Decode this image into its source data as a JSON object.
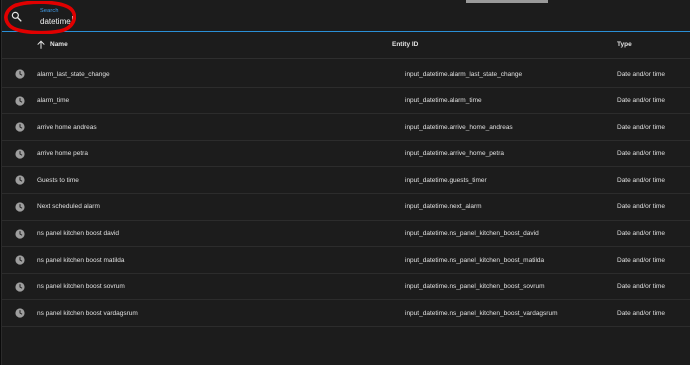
{
  "search": {
    "label": "Search",
    "value": "datetime"
  },
  "table": {
    "columns": {
      "name": "Name",
      "entity_id": "Entity ID",
      "type": "Type"
    },
    "rows": [
      {
        "name": "alarm_last_state_change",
        "entity_id": "input_datetime.alarm_last_state_change",
        "type": "Date and/or time"
      },
      {
        "name": "alarm_time",
        "entity_id": "input_datetime.alarm_time",
        "type": "Date and/or time"
      },
      {
        "name": "arrive home andreas",
        "entity_id": "input_datetime.arrive_home_andreas",
        "type": "Date and/or time"
      },
      {
        "name": "arrive home petra",
        "entity_id": "input_datetime.arrive_home_petra",
        "type": "Date and/or time"
      },
      {
        "name": "Guests to time",
        "entity_id": "input_datetime.guests_timer",
        "type": "Date and/or time"
      },
      {
        "name": "Next scheduled alarm",
        "entity_id": "input_datetime.next_alarm",
        "type": "Date and/or time"
      },
      {
        "name": "ns panel kitchen boost david",
        "entity_id": "input_datetime.ns_panel_kitchen_boost_david",
        "type": "Date and/or time"
      },
      {
        "name": "ns panel kitchen boost matilda",
        "entity_id": "input_datetime.ns_panel_kitchen_boost_matilda",
        "type": "Date and/or time"
      },
      {
        "name": "ns panel kitchen boost sovrum",
        "entity_id": "input_datetime.ns_panel_kitchen_boost_sovrum",
        "type": "Date and/or time"
      },
      {
        "name": "ns panel kitchen boost vardagsrum",
        "entity_id": "input_datetime.ns_panel_kitchen_boost_vardagsrum",
        "type": "Date and/or time"
      }
    ]
  },
  "icons": {
    "search": "search-icon",
    "sort": "arrow-up-icon",
    "row": "clock-icon"
  },
  "colors": {
    "accent": "#42a5f5",
    "annotation": "#e10000"
  }
}
